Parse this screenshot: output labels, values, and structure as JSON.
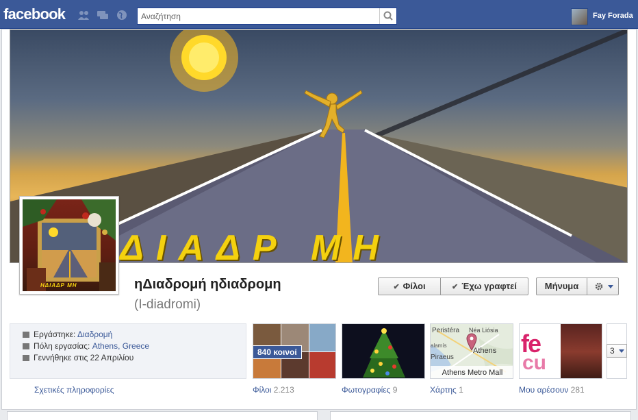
{
  "topbar": {
    "logo": "facebook",
    "search_placeholder": "Αναζήτηση",
    "user_name": "Fay Forada"
  },
  "cover": {
    "title": "ΔΙΑΔΡ ΜΗ"
  },
  "profile": {
    "name": "ηΔιαδρομή ηδιαδρομη",
    "alternate_name": "(I-diadromi)",
    "thumb_caption": "ΗΔΙΑΔΡ ΜΗ"
  },
  "actions": {
    "friends_label": "Φίλοι",
    "following_label": "Έχω γραφτεί",
    "message_label": "Μήνυμα"
  },
  "info": {
    "work_prefix": "Εργάστηκε:",
    "work_value": "Διαδρομή",
    "city_prefix": "Πόλη εργασίας:",
    "city_value": "Athens, Greece",
    "birthday": "Γεννήθηκε στις 22 Απριλίου",
    "about_link": "Σχετικές πληροφορίες"
  },
  "apps": {
    "friends": {
      "label": "Φίλοι",
      "count": "2.213",
      "badge": "840 κοινοί"
    },
    "photos": {
      "label": "Φωτογραφίες",
      "count": "9"
    },
    "map": {
      "label": "Χάρτης",
      "count": "1",
      "place": "Athens Metro Mall",
      "labels": {
        "peristeri": "Peristéra",
        "nealiosia": "Néa Liósia",
        "athens": "Athens",
        "piraeus": "Piraeus",
        "salamis": "alamís"
      }
    },
    "likes": {
      "label": "Μου αρέσουν",
      "count": "281"
    },
    "more_count": "3"
  },
  "colors": {
    "fb_blue": "#3b5998",
    "road_yellow": "#f4d10f"
  }
}
